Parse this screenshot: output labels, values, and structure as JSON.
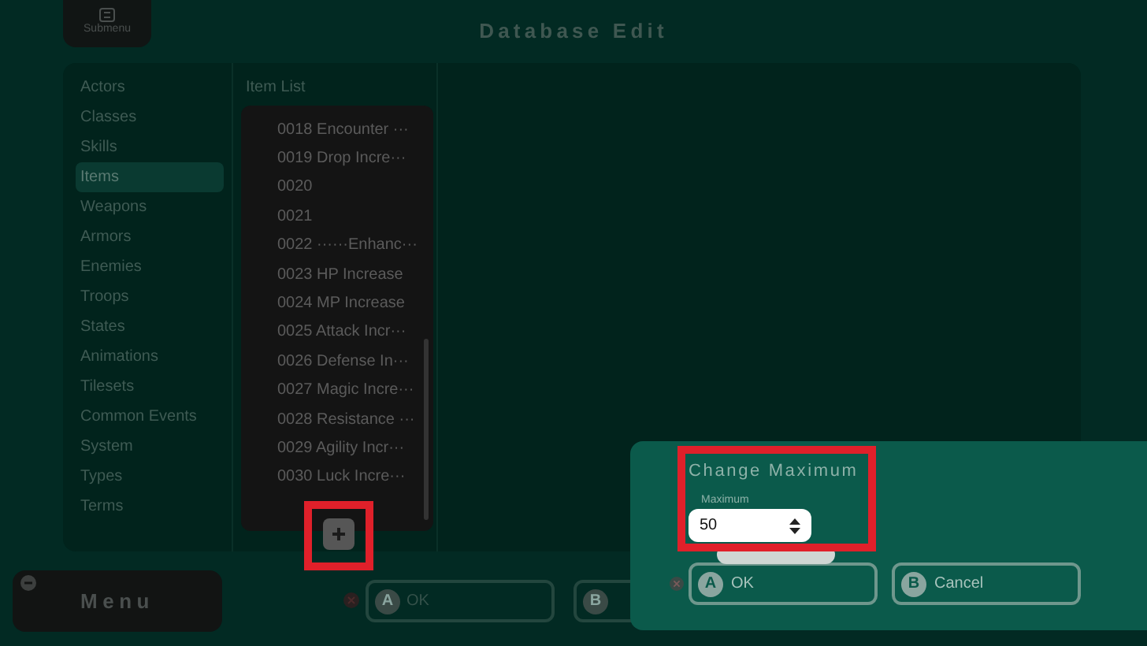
{
  "header": {
    "submenu_label": "Submenu",
    "title": "Database Edit"
  },
  "sidebar": {
    "items": [
      {
        "label": "Actors",
        "selected": false
      },
      {
        "label": "Classes",
        "selected": false
      },
      {
        "label": "Skills",
        "selected": false
      },
      {
        "label": "Items",
        "selected": true
      },
      {
        "label": "Weapons",
        "selected": false
      },
      {
        "label": "Armors",
        "selected": false
      },
      {
        "label": "Enemies",
        "selected": false
      },
      {
        "label": "Troops",
        "selected": false
      },
      {
        "label": "States",
        "selected": false
      },
      {
        "label": "Animations",
        "selected": false
      },
      {
        "label": "Tilesets",
        "selected": false
      },
      {
        "label": "Common Events",
        "selected": false
      },
      {
        "label": "System",
        "selected": false
      },
      {
        "label": "Types",
        "selected": false
      },
      {
        "label": "Terms",
        "selected": false
      }
    ]
  },
  "item_list": {
    "title": "Item List",
    "rows": [
      "0018 Encounter ···",
      "0019 Drop Incre···",
      "0020",
      "0021",
      "0022 ······Enhanc···",
      "0023 HP Increase",
      "0024 MP Increase",
      "0025 Attack Incr···",
      "0026 Defense In···",
      "0027 Magic Incre···",
      "0028 Resistance ···",
      "0029 Agility Incr···",
      "0030 Luck Incre···"
    ]
  },
  "bottom_bar": {
    "menu_label": "Menu",
    "buttons": [
      {
        "badge": "A",
        "label": "OK"
      },
      {
        "badge": "B"
      }
    ]
  },
  "dialog": {
    "title": "Change Maximum",
    "field_label": "Maximum",
    "value": "50",
    "buttons": [
      {
        "badge": "A",
        "label": "OK"
      },
      {
        "badge": "B",
        "label": "Cancel"
      }
    ]
  }
}
